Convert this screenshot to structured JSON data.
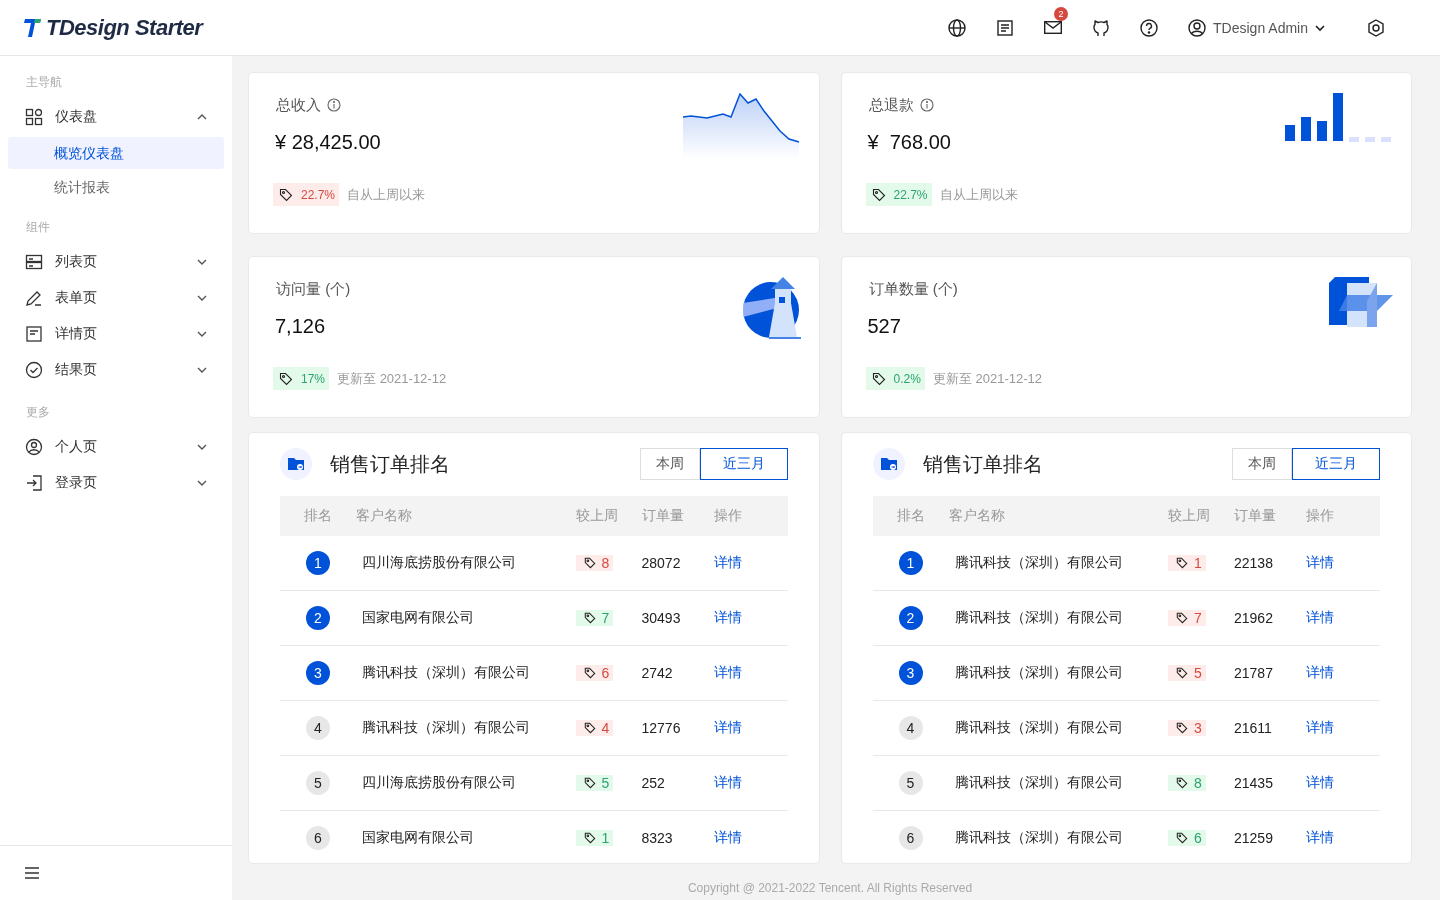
{
  "header": {
    "logo": "TDesign Starter",
    "notification_count": "2",
    "user_name": "TDesign Admin"
  },
  "sidebar": {
    "groups": [
      {
        "title": "主导航",
        "items": [
          {
            "label": "仪表盘",
            "expanded": true,
            "children": [
              {
                "label": "概览仪表盘",
                "selected": true
              },
              {
                "label": "统计报表",
                "selected": false
              }
            ]
          }
        ]
      },
      {
        "title": "组件",
        "items": [
          {
            "label": "列表页",
            "expanded": false
          },
          {
            "label": "表单页",
            "expanded": false
          },
          {
            "label": "详情页",
            "expanded": false
          },
          {
            "label": "结果页",
            "expanded": false
          }
        ]
      },
      {
        "title": "更多",
        "items": [
          {
            "label": "个人页",
            "expanded": false
          },
          {
            "label": "登录页",
            "expanded": false
          }
        ]
      }
    ]
  },
  "stats": [
    {
      "title": "总收入",
      "info": true,
      "value": "¥ 28,425.00",
      "change": "22.7%",
      "rising": true,
      "note": "自从上周以来",
      "kind": "sparkline"
    },
    {
      "title": "总退款",
      "info": true,
      "value": "¥  768.00",
      "change": "22.7%",
      "rising": false,
      "note": "自从上周以来",
      "kind": "bars"
    },
    {
      "title": "访问量 (个)",
      "info": false,
      "value": "7,126",
      "change": "17%",
      "rising": false,
      "note": "更新至 2021-12-12",
      "kind": "lighthouse"
    },
    {
      "title": "订单数量 (个)",
      "info": false,
      "value": "527",
      "change": "0.2%",
      "rising": false,
      "note": "更新至 2021-12-12",
      "kind": "boxes"
    }
  ],
  "rankings": [
    {
      "title": "销售订单排名",
      "tabs": [
        {
          "label": "本周",
          "selected": false
        },
        {
          "label": "近三月",
          "selected": true
        }
      ],
      "columns": [
        "排名",
        "客户名称",
        "较上周",
        "订单量",
        "操作"
      ],
      "rows": [
        {
          "rank": "1",
          "top": true,
          "name": "四川海底捞股份有限公司",
          "change": "8",
          "rising": true,
          "orders": "28072",
          "action": "详情"
        },
        {
          "rank": "2",
          "top": true,
          "name": "国家电网有限公司",
          "change": "7",
          "rising": false,
          "orders": "30493",
          "action": "详情"
        },
        {
          "rank": "3",
          "top": true,
          "name": "腾讯科技（深圳）有限公司",
          "change": "6",
          "rising": true,
          "orders": "2742",
          "action": "详情"
        },
        {
          "rank": "4",
          "top": false,
          "name": "腾讯科技（深圳）有限公司",
          "change": "4",
          "rising": true,
          "orders": "12776",
          "action": "详情"
        },
        {
          "rank": "5",
          "top": false,
          "name": "四川海底捞股份有限公司",
          "change": "5",
          "rising": false,
          "orders": "252",
          "action": "详情"
        },
        {
          "rank": "6",
          "top": false,
          "name": "国家电网有限公司",
          "change": "1",
          "rising": false,
          "orders": "8323",
          "action": "详情"
        }
      ]
    },
    {
      "title": "销售订单排名",
      "tabs": [
        {
          "label": "本周",
          "selected": false
        },
        {
          "label": "近三月",
          "selected": true
        }
      ],
      "columns": [
        "排名",
        "客户名称",
        "较上周",
        "订单量",
        "操作"
      ],
      "rows": [
        {
          "rank": "1",
          "top": true,
          "name": "腾讯科技（深圳）有限公司",
          "change": "1",
          "rising": true,
          "orders": "22138",
          "action": "详情"
        },
        {
          "rank": "2",
          "top": true,
          "name": "腾讯科技（深圳）有限公司",
          "change": "7",
          "rising": true,
          "orders": "21962",
          "action": "详情"
        },
        {
          "rank": "3",
          "top": true,
          "name": "腾讯科技（深圳）有限公司",
          "change": "5",
          "rising": true,
          "orders": "21787",
          "action": "详情"
        },
        {
          "rank": "4",
          "top": false,
          "name": "腾讯科技（深圳）有限公司",
          "change": "3",
          "rising": true,
          "orders": "21611",
          "action": "详情"
        },
        {
          "rank": "5",
          "top": false,
          "name": "腾讯科技（深圳）有限公司",
          "change": "8",
          "rising": false,
          "orders": "21435",
          "action": "详情"
        },
        {
          "rank": "6",
          "top": false,
          "name": "腾讯科技（深圳）有限公司",
          "change": "6",
          "rising": false,
          "orders": "21259",
          "action": "详情"
        }
      ]
    }
  ],
  "footer": {
    "copyright": "Copyright @ 2021-2022 Tencent. All Rights Reserved"
  }
}
